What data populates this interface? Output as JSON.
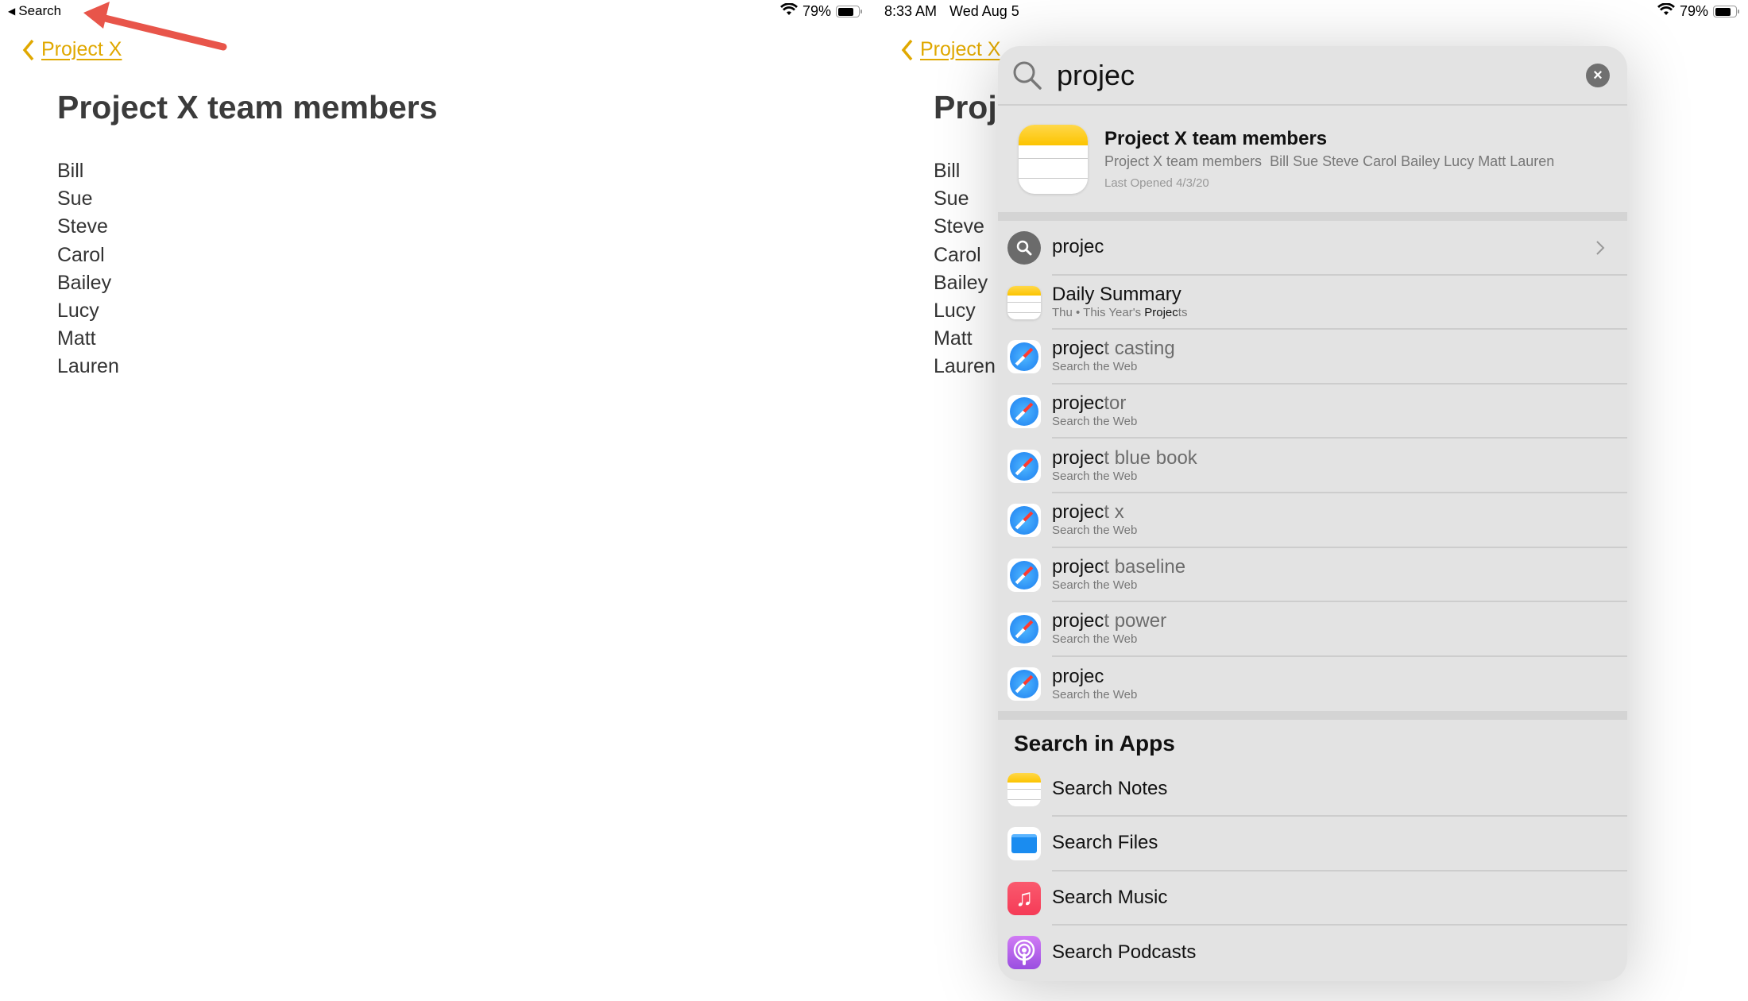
{
  "left": {
    "status": {
      "back_app": "Search",
      "battery": "79%",
      "battery_level": 0.79
    },
    "nav": {
      "back_label": "Project X"
    },
    "note": {
      "title": "Project X team members",
      "lines": [
        "Bill",
        "Sue",
        "Steve",
        "Carol",
        "Bailey",
        "Lucy",
        "Matt",
        "Lauren"
      ]
    },
    "toolbar_icons": [
      "share-collaborate-icon",
      "checklist-icon",
      "camera-icon",
      "markup-icon",
      "more-icon",
      "compose-icon"
    ],
    "annotation_arrow_color": "#e8554a"
  },
  "right": {
    "status": {
      "time": "8:33 AM",
      "date": "Wed Aug 5",
      "battery": "79%",
      "battery_level": 0.79
    },
    "nav": {
      "back_label": "Project X"
    },
    "note": {
      "title": "Project X team members",
      "lines": [
        "Bill",
        "Sue",
        "Steve",
        "Carol",
        "Bailey",
        "Lucy",
        "Matt",
        "Lauren"
      ]
    },
    "search": {
      "query": "projec",
      "top_hit": {
        "title": "Project X team members",
        "snippet": "Project X team members  Bill Sue Steve Carol Bailey Lucy Matt Lauren",
        "meta": "Last Opened 4/3/20"
      },
      "suggestion": {
        "title": "projec"
      },
      "note_result": {
        "title": "Daily Summary",
        "sub_prefix": "Thu • This Year's ",
        "sub_match": "Projec",
        "sub_rest": "ts"
      },
      "web_results": [
        {
          "match": "projec",
          "rest": "t casting",
          "sub": "Search the Web"
        },
        {
          "match": "projec",
          "rest": "tor",
          "sub": "Search the Web"
        },
        {
          "match": "projec",
          "rest": "t blue book",
          "sub": "Search the Web"
        },
        {
          "match": "projec",
          "rest": "t x",
          "sub": "Search the Web"
        },
        {
          "match": "projec",
          "rest": "t baseline",
          "sub": "Search the Web"
        },
        {
          "match": "projec",
          "rest": "t power",
          "sub": "Search the Web"
        },
        {
          "match": "projec",
          "rest": "",
          "sub": "Search the Web"
        }
      ],
      "apps_header": "Search in Apps",
      "apps": [
        {
          "label": "Search Notes",
          "icon": "notes-icon",
          "color": "#fcc400"
        },
        {
          "label": "Search Files",
          "icon": "files-icon",
          "color": "#1a8cf0"
        },
        {
          "label": "Search Music",
          "icon": "music-icon",
          "color": "#f53b57"
        },
        {
          "label": "Search Podcasts",
          "icon": "podcasts-icon",
          "color": "#9a4ee0"
        }
      ]
    }
  },
  "colors": {
    "accent": "#e0a800"
  }
}
